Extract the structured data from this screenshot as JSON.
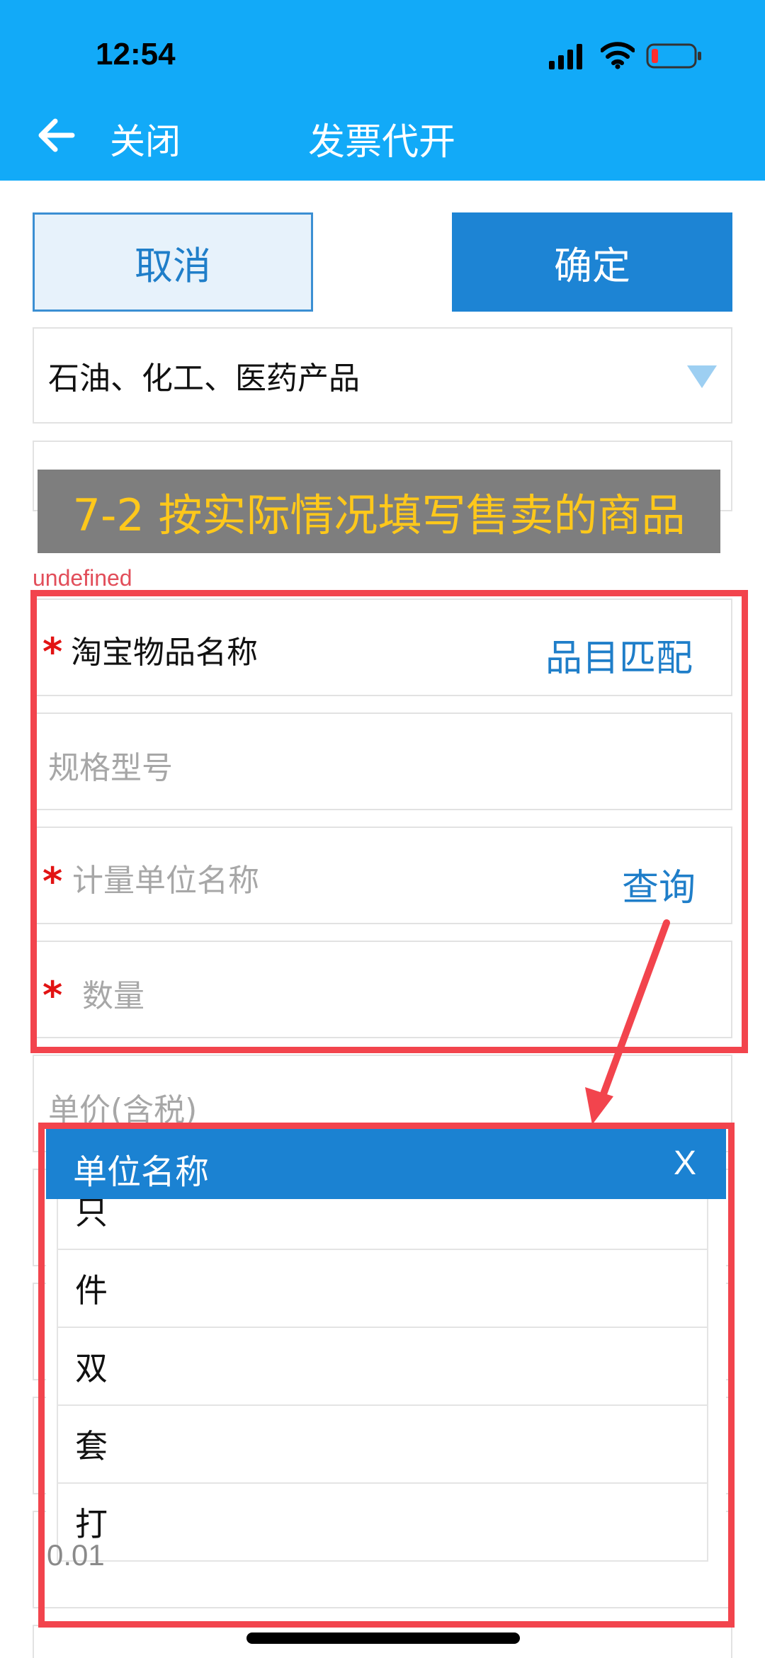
{
  "status_bar": {
    "time": "12:54",
    "icons": [
      "signal-icon",
      "wifi-icon",
      "battery-low-icon"
    ]
  },
  "nav": {
    "back_icon": "back-arrow-icon",
    "close_label": "关闭",
    "title": "发票代开"
  },
  "actions": {
    "cancel_label": "取消",
    "confirm_label": "确定"
  },
  "category_select": {
    "value": "石油、化工、医药产品"
  },
  "annotation": {
    "text": "7-2 按实际情况填写售卖的商品"
  },
  "warning_text": "undefined",
  "form": {
    "item_name": {
      "label": "淘宝物品名称",
      "required": true,
      "action": "品目匹配"
    },
    "spec": {
      "placeholder": "规格型号"
    },
    "unit": {
      "placeholder": "计量单位名称",
      "required": true,
      "action": "查询"
    },
    "quantity": {
      "placeholder": "数量",
      "required": true
    },
    "unit_price": {
      "placeholder": "单价(含税)"
    },
    "price_value": "0.01"
  },
  "unit_dialog": {
    "title": "单位名称",
    "close_label": "X",
    "options": [
      "只",
      "件",
      "双",
      "套",
      "打"
    ]
  },
  "colors": {
    "header_blue": "#12aaf8",
    "primary_blue": "#1d84d4",
    "link_blue": "#1f7ec9",
    "highlight_red": "#f2444d",
    "annotation_yellow": "#ffc81b"
  }
}
